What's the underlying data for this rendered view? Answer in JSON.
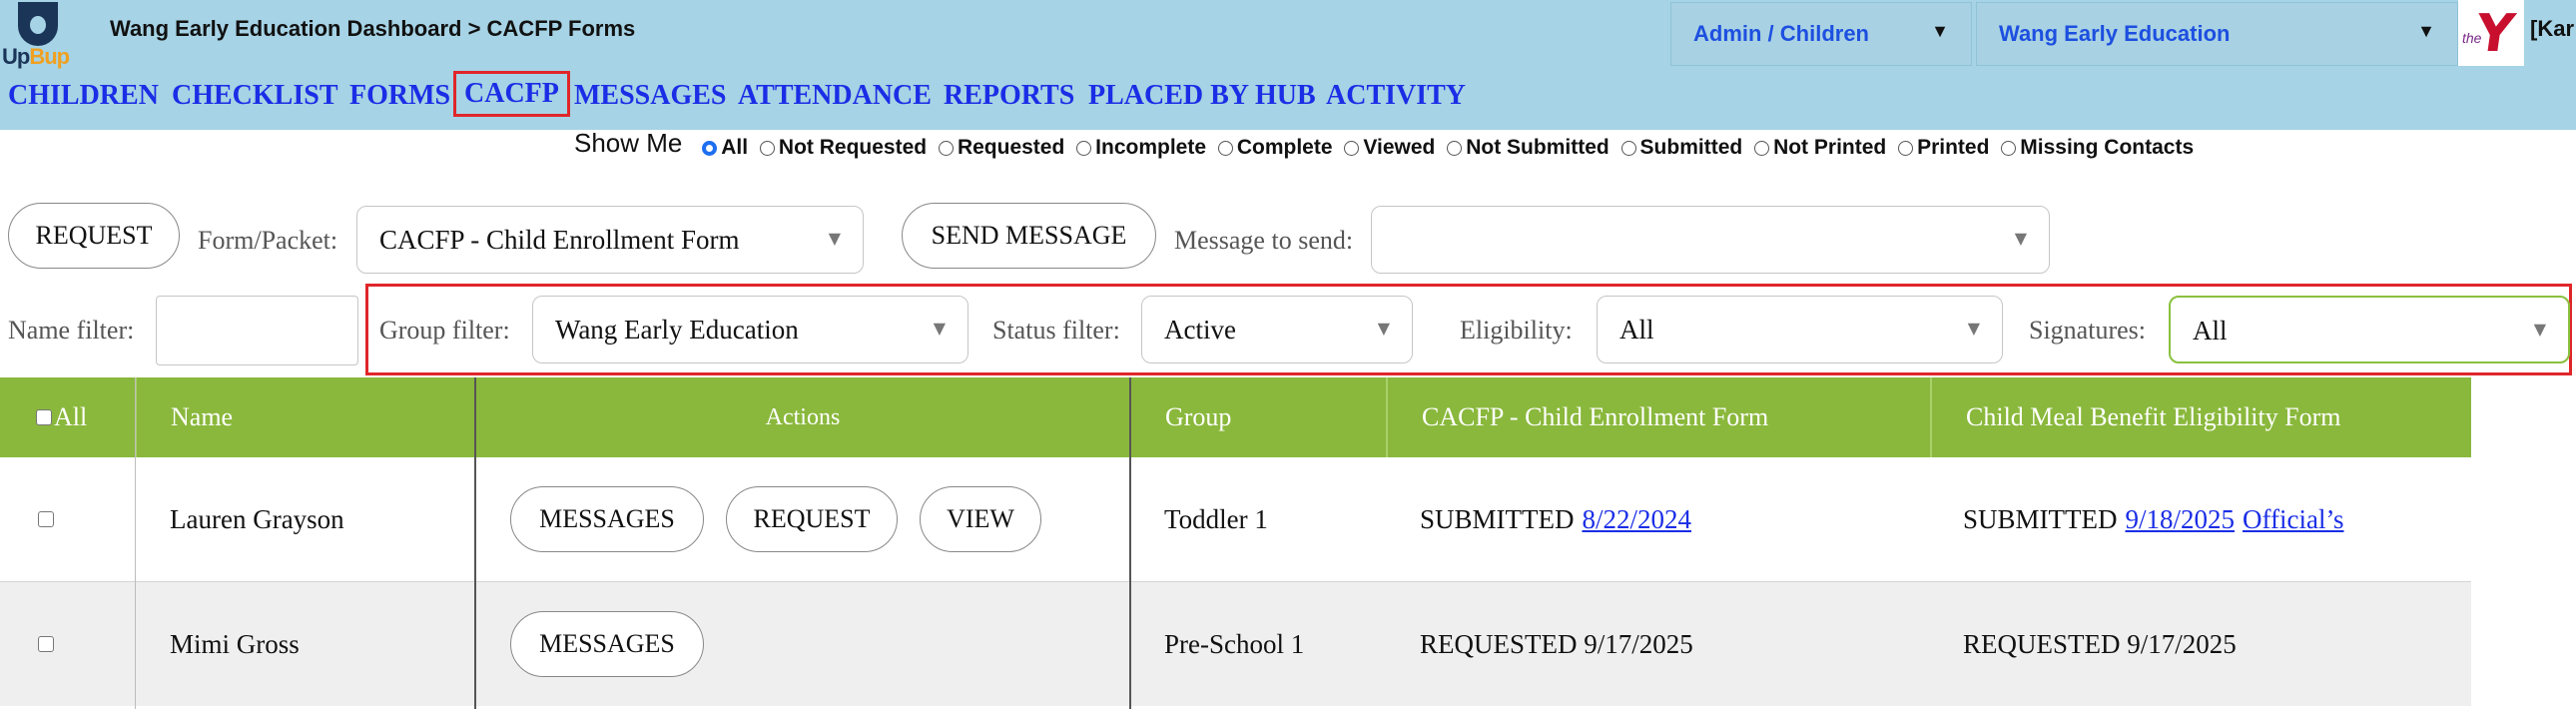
{
  "logo": {
    "mark": "U",
    "text_a": "Up",
    "text_b": "Bup"
  },
  "header": {
    "breadcrumb": "Wang Early Education Dashboard > CACFP Forms",
    "role_select": "Admin / Children",
    "org_select": "Wang Early Education",
    "ymca_icon": "ymca-logo",
    "user_tag": "[Kar"
  },
  "nav": {
    "items": [
      "CHILDREN",
      "CHECKLIST",
      "FORMS",
      "CACFP",
      "MESSAGES",
      "ATTENDANCE",
      "REPORTS",
      "PLACED BY HUB",
      "ACTIVITY"
    ],
    "active": "CACFP"
  },
  "show_me": {
    "label": "Show Me",
    "options": [
      "All",
      "Not Requested",
      "Requested",
      "Incomplete",
      "Complete",
      "Viewed",
      "Not Submitted",
      "Submitted",
      "Not Printed",
      "Printed",
      "Missing Contacts"
    ],
    "selected": "All"
  },
  "toolbar": {
    "request_button": "REQUEST",
    "form_packet_label": "Form/Packet:",
    "form_packet_value": "CACFP - Child Enrollment Form",
    "send_message_button": "SEND MESSAGE",
    "message_label": "Message to send:",
    "message_value": ""
  },
  "filters": {
    "name_label": "Name filter:",
    "name_value": "",
    "group_label": "Group filter:",
    "group_value": "Wang Early Education",
    "status_label": "Status filter:",
    "status_value": "Active",
    "eligibility_label": "Eligibility:",
    "eligibility_value": "All",
    "signatures_label": "Signatures:",
    "signatures_value": "All"
  },
  "table": {
    "headers": {
      "select_all": "All",
      "name": "Name",
      "actions": "Actions",
      "group": "Group",
      "enrollment": "CACFP - Child Enrollment Form",
      "meal_benefit": "Child Meal Benefit Eligibility Form"
    },
    "rows": [
      {
        "name": "Lauren Grayson",
        "actions": [
          "MESSAGES",
          "REQUEST",
          "VIEW"
        ],
        "group": "Toddler 1",
        "enrollment_status": "SUBMITTED",
        "enrollment_date": "8/22/2024",
        "meal_status": "SUBMITTED",
        "meal_date": "9/18/2025",
        "meal_link": "Official’s"
      },
      {
        "name": "Mimi Gross",
        "actions": [
          "MESSAGES"
        ],
        "group": "Pre-School 1",
        "enrollment_status": "REQUESTED 9/17/2025",
        "meal_status": "REQUESTED 9/17/2025"
      }
    ]
  },
  "colors": {
    "topbar": "#a6d3e5",
    "nav_link": "#1a2ee6",
    "table_header": "#8ab83c",
    "highlight_box": "#e0262a",
    "radio_selected": "#1e6ff0"
  }
}
